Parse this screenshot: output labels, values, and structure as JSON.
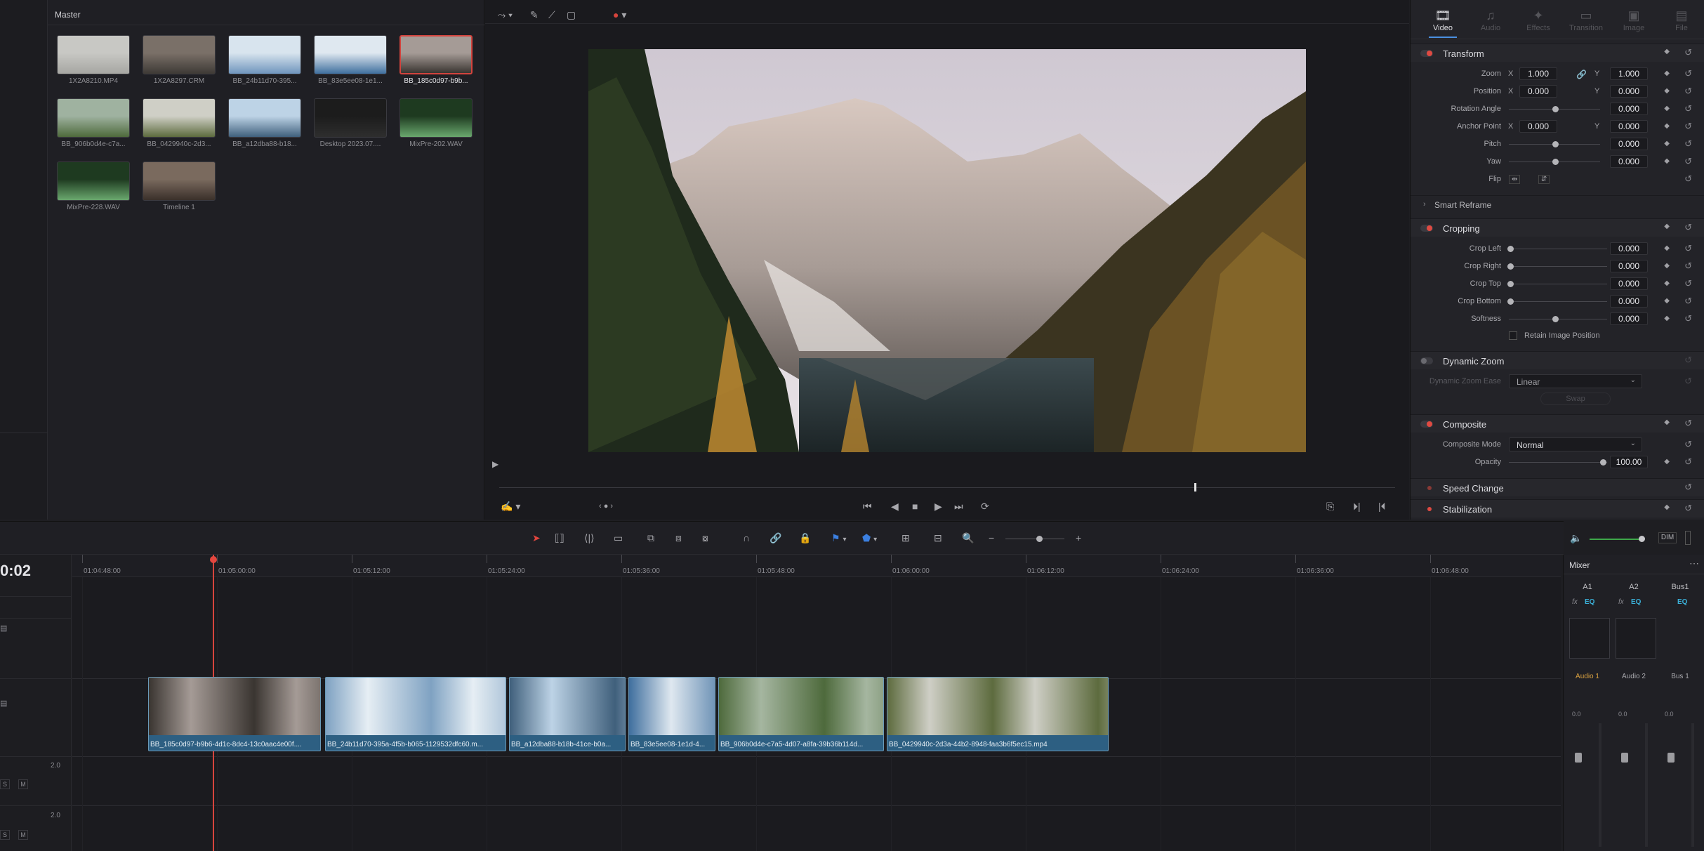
{
  "media_pool": {
    "title": "Master",
    "clips": [
      {
        "name": "1X2A8210.MP4",
        "colors": [
          "#c8c8c4",
          "#a6a6a2"
        ],
        "selected": false
      },
      {
        "name": "1X2A8297.CRM",
        "colors": [
          "#7a7068",
          "#3e3a36"
        ],
        "selected": false
      },
      {
        "name": "BB_24b11d70-395...",
        "colors": [
          "#d8e4ee",
          "#6f95bd"
        ],
        "selected": false
      },
      {
        "name": "BB_83e5ee08-1e1...",
        "colors": [
          "#dfe8f0",
          "#3f6f9e"
        ],
        "selected": false
      },
      {
        "name": "BB_185c0d97-b9b...",
        "colors": [
          "#a59b96",
          "#3a3531"
        ],
        "selected": true
      },
      {
        "name": "BB_906b0d4e-c7a...",
        "colors": [
          "#9fb2a0",
          "#4e6a3c"
        ],
        "selected": false
      },
      {
        "name": "BB_0429940c-2d3...",
        "colors": [
          "#cfcfc6",
          "#5d6b3e"
        ],
        "selected": false
      },
      {
        "name": "BB_a12dba88-b18...",
        "colors": [
          "#bdd3e6",
          "#40607c"
        ],
        "selected": false
      },
      {
        "name": "Desktop 2023.07....",
        "colors": [
          "#1c1c1c",
          "#2e2e2e"
        ],
        "selected": false
      },
      {
        "name": "MixPre-202.WAV",
        "colors": [
          "#1e3a20",
          "#6aa86e"
        ],
        "selected": false
      },
      {
        "name": "MixPre-228.WAV",
        "colors": [
          "#1e3a20",
          "#6aa86e"
        ],
        "selected": false
      },
      {
        "name": "Timeline 1",
        "colors": [
          "#7a6a5e",
          "#3a302a"
        ],
        "selected": false
      }
    ]
  },
  "inspector": {
    "tabs": [
      {
        "label": "Video",
        "icon": "film-icon",
        "glyph": "🎞",
        "active": true
      },
      {
        "label": "Audio",
        "icon": "music-icon",
        "glyph": "♫",
        "active": false
      },
      {
        "label": "Effects",
        "icon": "wand-icon",
        "glyph": "✦",
        "active": false
      },
      {
        "label": "Transition",
        "icon": "transition-icon",
        "glyph": "▭",
        "active": false
      },
      {
        "label": "Image",
        "icon": "image-icon",
        "glyph": "▣",
        "active": false
      },
      {
        "label": "File",
        "icon": "file-icon",
        "glyph": "▤",
        "active": false
      }
    ],
    "transform": {
      "title": "Transform",
      "zoom": {
        "label": "Zoom",
        "x": "1.000",
        "y": "1.000"
      },
      "position": {
        "label": "Position",
        "x": "0.000",
        "y": "0.000"
      },
      "rotation": {
        "label": "Rotation Angle",
        "value": "0.000"
      },
      "anchor": {
        "label": "Anchor Point",
        "x": "0.000",
        "y": "0.000"
      },
      "pitch": {
        "label": "Pitch",
        "value": "0.000"
      },
      "yaw": {
        "label": "Yaw",
        "value": "0.000"
      },
      "flip": {
        "label": "Flip"
      },
      "axis_x": "X",
      "axis_y": "Y"
    },
    "smart_reframe": {
      "title": "Smart Reframe"
    },
    "cropping": {
      "title": "Cropping",
      "rows": [
        {
          "label": "Crop Left",
          "value": "0.000"
        },
        {
          "label": "Crop Right",
          "value": "0.000"
        },
        {
          "label": "Crop Top",
          "value": "0.000"
        },
        {
          "label": "Crop Bottom",
          "value": "0.000"
        },
        {
          "label": "Softness",
          "value": "0.000"
        }
      ],
      "retain": "Retain Image Position"
    },
    "dynamic_zoom": {
      "title": "Dynamic Zoom",
      "ease_label": "Dynamic Zoom Ease",
      "ease_value": "Linear",
      "swap": "Swap"
    },
    "composite": {
      "title": "Composite",
      "mode_label": "Composite Mode",
      "mode_value": "Normal",
      "opacity_label": "Opacity",
      "opacity_value": "100.00"
    },
    "speed_change": {
      "title": "Speed Change"
    },
    "stabilization": {
      "title": "Stabilization"
    }
  },
  "timeline": {
    "timecode": "0:02",
    "ruler": [
      "01:04:48:00",
      "01:05:00:00",
      "01:05:12:00",
      "01:05:24:00",
      "01:05:36:00",
      "01:05:48:00",
      "01:06:00:00",
      "01:06:12:00",
      "01:06:24:00",
      "01:06:36:00",
      "01:06:48:00"
    ],
    "clips": [
      {
        "label": "BB_185c0d97-b9b6-4d1c-8dc4-13c0aac4e00f....",
        "colors": [
          "#a59b96",
          "#3a3531"
        ]
      },
      {
        "label": "BB_24b11d70-395a-4f5b-b065-1129532dfc60.m...",
        "colors": [
          "#e6eef4",
          "#7fa2c2"
        ]
      },
      {
        "label": "BB_a12dba88-b18b-41ce-b0a...",
        "colors": [
          "#bdd3e6",
          "#40607c"
        ]
      },
      {
        "label": "BB_83e5ee08-1e1d-4...",
        "colors": [
          "#dfe8f0",
          "#3f6f9e"
        ]
      },
      {
        "label": "BB_906b0d4e-c7a5-4d07-a8fa-39b36b114d...",
        "colors": [
          "#a5b6a0",
          "#4e6a3c"
        ]
      },
      {
        "label": "BB_0429940c-2d3a-44b2-8948-faa3b6f5ec15.mp4",
        "colors": [
          "#cfcfc6",
          "#5d6b3e"
        ]
      }
    ],
    "audio_level_1": "2.0",
    "audio_level_2": "2.0",
    "solo": "S",
    "mute": "M"
  },
  "mixer": {
    "title": "Mixer",
    "columns": [
      "A1",
      "A2",
      "Bus1"
    ],
    "fx": "fx",
    "eq": "EQ",
    "channel_names": [
      "Audio 1",
      "Audio 2",
      "Bus 1"
    ],
    "db": "0.0",
    "dim": "DIM"
  }
}
